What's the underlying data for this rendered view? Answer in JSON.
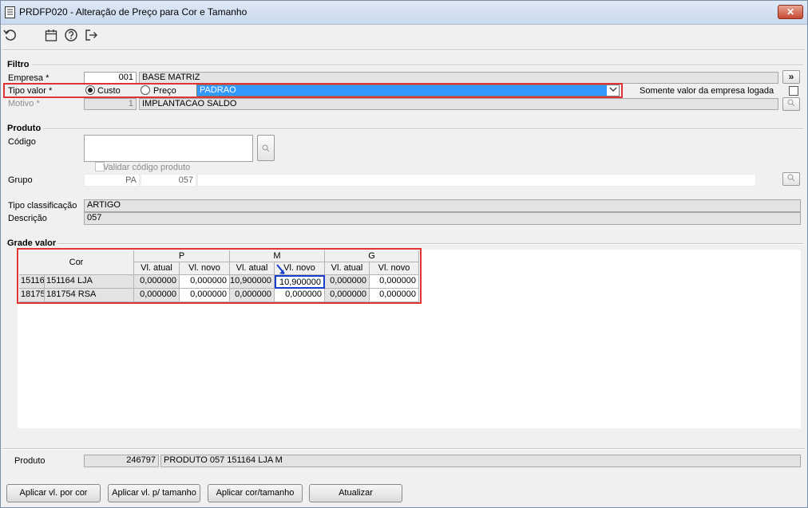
{
  "window": {
    "title": "PRDFP020 - Alteração de Preço para Cor e Tamanho",
    "close_label": "✕"
  },
  "toolbar": {
    "icons": [
      "undo-icon",
      "calendar-icon",
      "help-icon",
      "exit-icon"
    ]
  },
  "filtro": {
    "title": "Filtro",
    "empresa_label": "Empresa *",
    "empresa_code": "001",
    "empresa_name": "BASE MATRIZ",
    "expand_label": "»",
    "tipo_valor_label": "Tipo valor *",
    "radio_custo": "Custo",
    "radio_preco": "Preço",
    "tipo_valor_selected": "Custo",
    "tabela_selected": "PADRAO",
    "somente_label": "Somente valor da empresa logada",
    "somente_checked": false,
    "motivo_label": "Motivo *",
    "motivo_code": "1",
    "motivo_name": "IMPLANTACAO SALDO"
  },
  "produto": {
    "title": "Produto",
    "codigo_label": "Código",
    "codigo_value": "",
    "validar_label": "Validar código produto",
    "validar_checked": false,
    "grupo_label": "Grupo",
    "grupo_code1": "PA",
    "grupo_code2": "057",
    "grupo_desc": "",
    "tipo_class_label": "Tipo classificação",
    "tipo_class_value": "ARTIGO",
    "descricao_label": "Descrição",
    "descricao_value": "057"
  },
  "grade": {
    "title": "Grade valor",
    "cor_header": "Cor",
    "sizes": [
      "P",
      "M",
      "G"
    ],
    "sub_headers": [
      "Vl. atual",
      "Vl. novo"
    ],
    "rows": [
      {
        "code": "151164",
        "name": "151164 LJA",
        "values": [
          "0,000000",
          "0,000000",
          "10,900000",
          "10,900000",
          "0,000000",
          "0,000000"
        ]
      },
      {
        "code": "181754",
        "name": "181754 RSA",
        "values": [
          "0,000000",
          "0,000000",
          "0,000000",
          "0,000000",
          "0,000000",
          "0,000000"
        ]
      }
    ]
  },
  "footer": {
    "produto_label": "Produto",
    "produto_code": "246797",
    "produto_desc": "PRODUTO 057 151164 LJA M"
  },
  "buttons": {
    "aplicar_cor": "Aplicar vl. por cor",
    "aplicar_tamanho": "Aplicar vl. p/ tamanho",
    "aplicar_cor_tamanho": "Aplicar cor/tamanho",
    "atualizar": "Atualizar"
  }
}
